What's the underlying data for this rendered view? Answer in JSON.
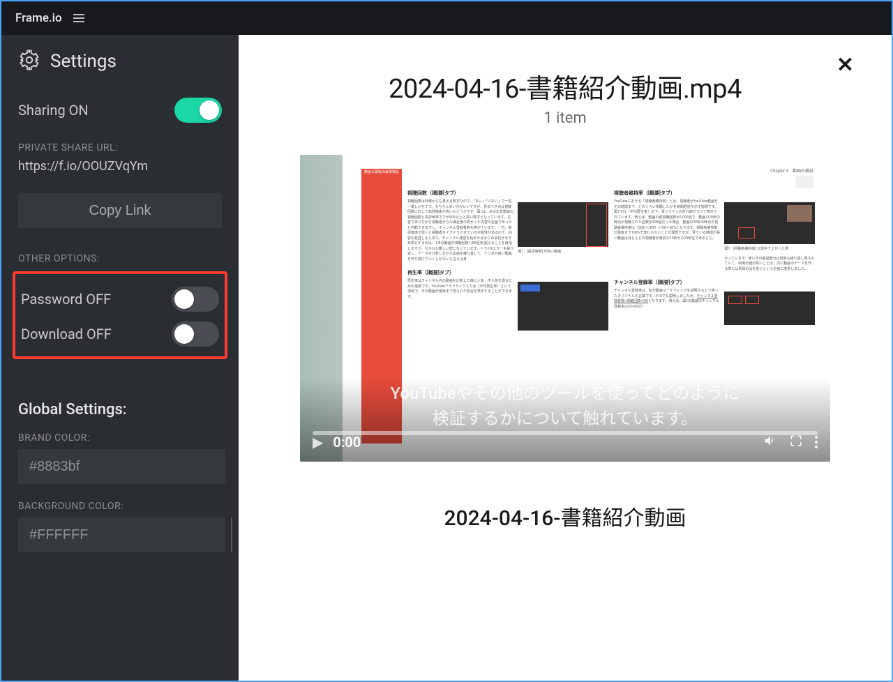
{
  "app": {
    "brand": "Frame.io"
  },
  "sidebar": {
    "settings_title": "Settings",
    "sharing_label": "Sharing ON",
    "sharing_on": true,
    "share_url_label": "PRIVATE SHARE URL:",
    "share_url": "https://f.io/OOUZVqYm",
    "copy_label": "Copy Link",
    "other_options_label": "OTHER OPTIONS:",
    "password_label": "Password OFF",
    "password_on": false,
    "download_label": "Download OFF",
    "download_on": false,
    "global_title": "Global Settings:",
    "brand_color_label": "BRAND COLOR:",
    "brand_color": "#8883bf",
    "bg_color_label": "BACKGROUND COLOR:",
    "bg_color": "#FFFFFF"
  },
  "content": {
    "file_title": "2024-04-16-書籍紹介動画.mp4",
    "item_count": "1 item",
    "timecode": "0:00",
    "subtitle_line1": "YouTubeやその他のツールを使ってどのように",
    "subtitle_line2": "検証するかについて触れています。",
    "caption_title": "2024-04-16-書籍紹介動画",
    "page": {
      "banner": "動画公開後の成果検証",
      "chapter": "Chapter 4　動画の検証",
      "col1_h1": "視聴回数（[概要]タブ）",
      "col1_h2": "再生率（[概要]タブ）",
      "col2_h1": "視聴者維持率（[概要]タブ）",
      "col2_h2": "チャンネル登録率（[概要]タブ）"
    }
  }
}
